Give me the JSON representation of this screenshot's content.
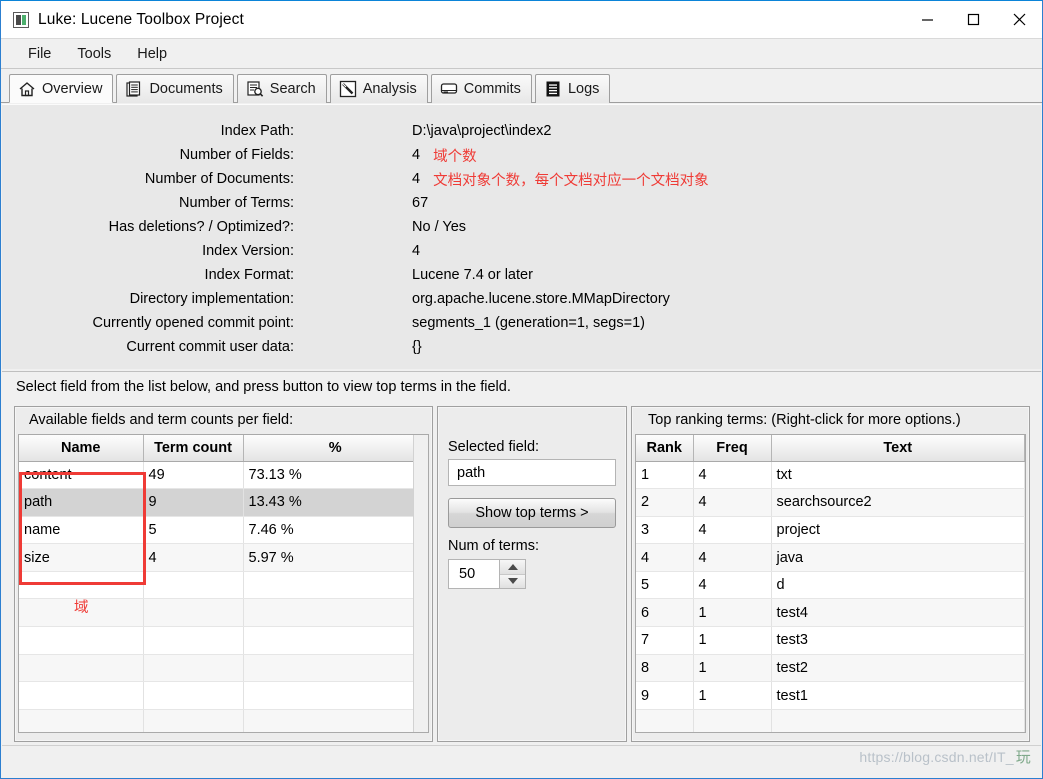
{
  "window": {
    "title": "Luke: Lucene Toolbox Project",
    "icon": "app-icon",
    "minimize": "—",
    "maximize": "□",
    "close": "×"
  },
  "menubar": {
    "items": [
      {
        "label": "File"
      },
      {
        "label": "Tools"
      },
      {
        "label": "Help"
      }
    ]
  },
  "tabs": [
    {
      "label": "Overview",
      "icon": "home-icon",
      "active": true
    },
    {
      "label": "Documents",
      "icon": "documents-icon",
      "active": false
    },
    {
      "label": "Search",
      "icon": "search-icon",
      "active": false
    },
    {
      "label": "Analysis",
      "icon": "wand-icon",
      "active": false
    },
    {
      "label": "Commits",
      "icon": "disk-icon",
      "active": false
    },
    {
      "label": "Logs",
      "icon": "logs-icon",
      "active": false
    }
  ],
  "overview": {
    "rows": [
      {
        "label": "Index Path:",
        "value": "D:\\java\\project\\index2",
        "note": ""
      },
      {
        "label": "Number of Fields:",
        "value": "4",
        "note": "域个数"
      },
      {
        "label": "Number of Documents:",
        "value": "4",
        "note": "文档对象个数，每个文档对应一个文档对象"
      },
      {
        "label": "Number of Terms:",
        "value": "67",
        "note": ""
      },
      {
        "label": "Has deletions? / Optimized?:",
        "value": "No / Yes",
        "note": ""
      },
      {
        "label": "Index Version:",
        "value": "4",
        "note": ""
      },
      {
        "label": "Index Format:",
        "value": "Lucene 7.4 or later",
        "note": ""
      },
      {
        "label": "Directory implementation:",
        "value": "org.apache.lucene.store.MMapDirectory",
        "note": ""
      },
      {
        "label": "Currently opened commit point:",
        "value": "segments_1 (generation=1, segs=1)",
        "note": ""
      },
      {
        "label": "Current commit user data:",
        "value": "{}",
        "note": ""
      }
    ]
  },
  "helper_text": "Select field from the list below, and press button to view top terms in the field.",
  "fields_panel": {
    "title": "Available fields and term counts per field:",
    "columns": [
      "Name",
      "Term count",
      "%"
    ],
    "rows": [
      {
        "name": "content",
        "term_count": "49",
        "percent": "73.13 %",
        "selected": false
      },
      {
        "name": "path",
        "term_count": "9",
        "percent": "13.43 %",
        "selected": true
      },
      {
        "name": "name",
        "term_count": "5",
        "percent": "7.46 %",
        "selected": false
      },
      {
        "name": "size",
        "term_count": "4",
        "percent": "5.97 %",
        "selected": false
      }
    ],
    "empty_row_count": 6,
    "annotation": "域"
  },
  "selected_panel": {
    "selected_field_label": "Selected field:",
    "selected_field_value": "path",
    "show_top_terms_button": "Show top terms >",
    "num_of_terms_label": "Num of terms:",
    "num_of_terms_value": "50"
  },
  "terms_panel": {
    "title": "Top ranking terms: (Right-click for more options.)",
    "columns": [
      "Rank",
      "Freq",
      "Text"
    ],
    "rows": [
      {
        "rank": "1",
        "freq": "4",
        "text": "txt"
      },
      {
        "rank": "2",
        "freq": "4",
        "text": "searchsource2"
      },
      {
        "rank": "3",
        "freq": "4",
        "text": "project"
      },
      {
        "rank": "4",
        "freq": "4",
        "text": "java"
      },
      {
        "rank": "5",
        "freq": "4",
        "text": "d"
      },
      {
        "rank": "6",
        "freq": "1",
        "text": "test4"
      },
      {
        "rank": "7",
        "freq": "1",
        "text": "test3"
      },
      {
        "rank": "8",
        "freq": "1",
        "text": "test2"
      },
      {
        "rank": "9",
        "freq": "1",
        "text": "test1"
      }
    ],
    "empty_row_count": 1
  },
  "watermark": {
    "url": "https://blog.csdn.net/IT_",
    "suffix": "玩"
  },
  "colors": {
    "annotation_red": "#ef3b36",
    "title_border_blue": "#2c7fd0",
    "panel_bg": "#e8e8e8",
    "app_bg": "#f0f0f0",
    "row_selected": "#d3d3d3"
  }
}
